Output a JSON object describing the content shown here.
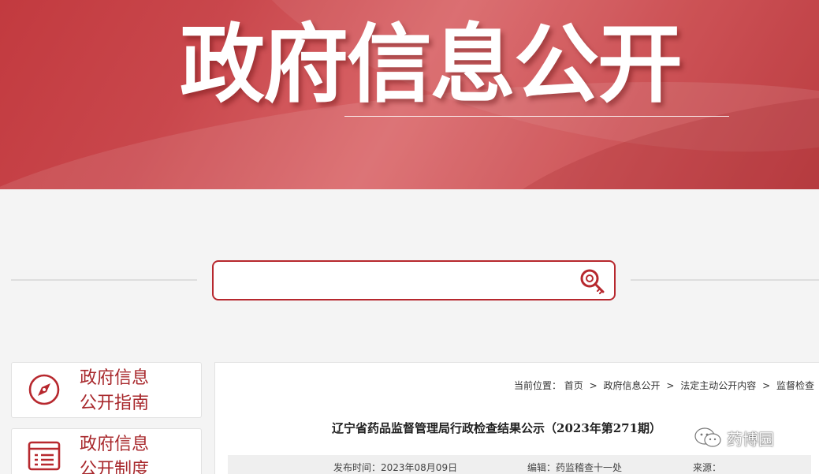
{
  "banner": {
    "title": "政府信息公开"
  },
  "search": {
    "placeholder": "",
    "value": ""
  },
  "side_menu": [
    {
      "line1": "政府信息",
      "line2": "公开指南",
      "icon": "compass-icon"
    },
    {
      "line1": "政府信息",
      "line2": "公开制度",
      "icon": "document-list-icon"
    }
  ],
  "breadcrumb": {
    "prefix": "当前位置：",
    "items": [
      "首页",
      "政府信息公开",
      "法定主动公开内容",
      "监督检查"
    ],
    "separator": ">"
  },
  "article": {
    "title": "辽宁省药品监督管理局行政检查结果公示（2023年第271期）",
    "publish_label": "发布时间：2023年08月09日",
    "editor_label": "编辑：药监稽查十一处",
    "source_label": "来源："
  },
  "watermark": {
    "text": "药博园",
    "icon": "wechat-icon"
  },
  "colors": {
    "brand": "#b7282e",
    "accent": "#a8282c"
  }
}
